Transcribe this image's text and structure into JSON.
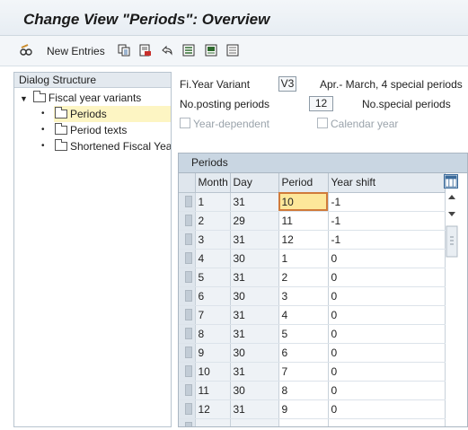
{
  "window": {
    "title": "Change View \"Periods\": Overview"
  },
  "toolbar": {
    "new_entries_label": "New Entries",
    "icons": [
      "edit-glasses-icon",
      "copy-icon",
      "delete-icon",
      "undo-icon",
      "select-all-icon",
      "select-block-icon",
      "deselect-all-icon"
    ]
  },
  "dialog": {
    "title": "Dialog Structure",
    "root": "Fiscal year variants",
    "items": [
      "Periods",
      "Period texts",
      "Shortened Fiscal Yea"
    ],
    "selected": "Periods"
  },
  "header": {
    "variant_label": "Fi.Year Variant",
    "variant_value": "V3",
    "variant_desc": "Apr.- March, 4 special periods",
    "posting_label": "No.posting periods",
    "posting_value": "12",
    "special_label": "No.special periods",
    "year_dependent_label": "Year-dependent",
    "calendar_year_label": "Calendar year"
  },
  "table": {
    "caption": "Periods",
    "columns": [
      "Month",
      "Day",
      "Period",
      "Year shift"
    ],
    "rows": [
      [
        "1",
        "31",
        "10",
        "-1"
      ],
      [
        "2",
        "29",
        "11",
        "-1"
      ],
      [
        "3",
        "31",
        "12",
        "-1"
      ],
      [
        "4",
        "30",
        "1",
        "0"
      ],
      [
        "5",
        "31",
        "2",
        "0"
      ],
      [
        "6",
        "30",
        "3",
        "0"
      ],
      [
        "7",
        "31",
        "4",
        "0"
      ],
      [
        "8",
        "31",
        "5",
        "0"
      ],
      [
        "9",
        "30",
        "6",
        "0"
      ],
      [
        "10",
        "31",
        "7",
        "0"
      ],
      [
        "11",
        "30",
        "8",
        "0"
      ],
      [
        "12",
        "31",
        "9",
        "0"
      ]
    ]
  },
  "colors": {
    "selected_row": "#fdf5c3",
    "active_cell": "#fde79a",
    "caption_bg": "#c9d6e2"
  }
}
